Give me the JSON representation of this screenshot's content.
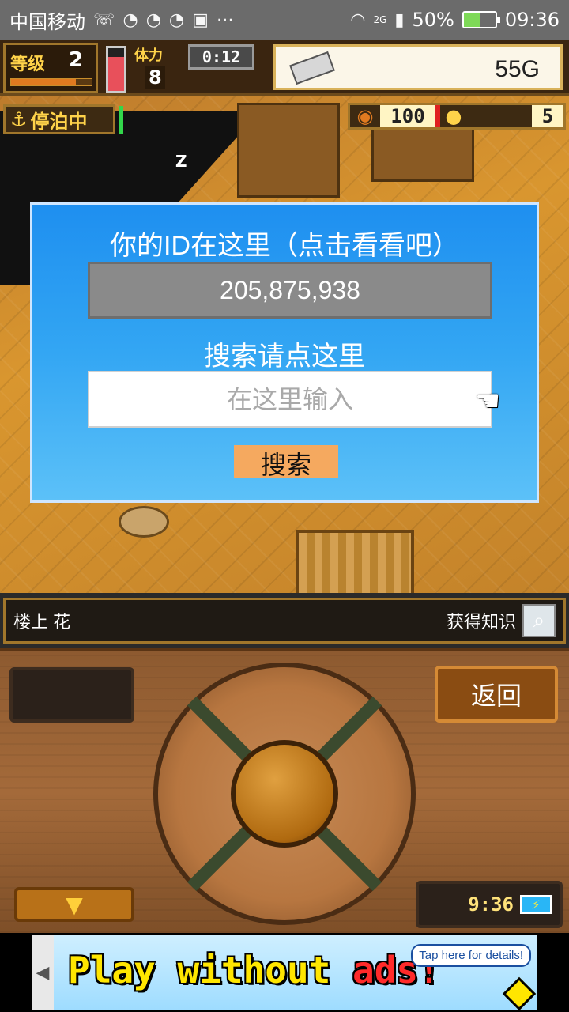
{
  "status_bar": {
    "carrier": "中国移动",
    "network": "2G",
    "battery": "50%",
    "battery_level": 0.5,
    "time": "09:36"
  },
  "hud": {
    "level_label": "等级",
    "level_value": "2",
    "level_progress": 0.8,
    "energy_level": 0.8,
    "stamina_label": "体力",
    "stamina_value": "8",
    "timer": "0:12",
    "gold": "55G",
    "status_label": "停泊中",
    "food_value": "100",
    "coin_value": "5"
  },
  "scene": {
    "z_mark": "Z"
  },
  "dialog": {
    "title": "你的ID在这里（点击看看吧）",
    "id_value": "205,875,938",
    "search_hint": "搜索请点这里",
    "search_placeholder": "在这里输入",
    "search_button": "搜索"
  },
  "location_bar": {
    "location": "楼上 花",
    "knowledge_label": "获得知识"
  },
  "panel": {
    "back_button": "返回",
    "clock": "9:36"
  },
  "ad": {
    "text_part1": "Play without",
    "text_part2": "ads!",
    "tap_label": "Tap here for details!"
  }
}
